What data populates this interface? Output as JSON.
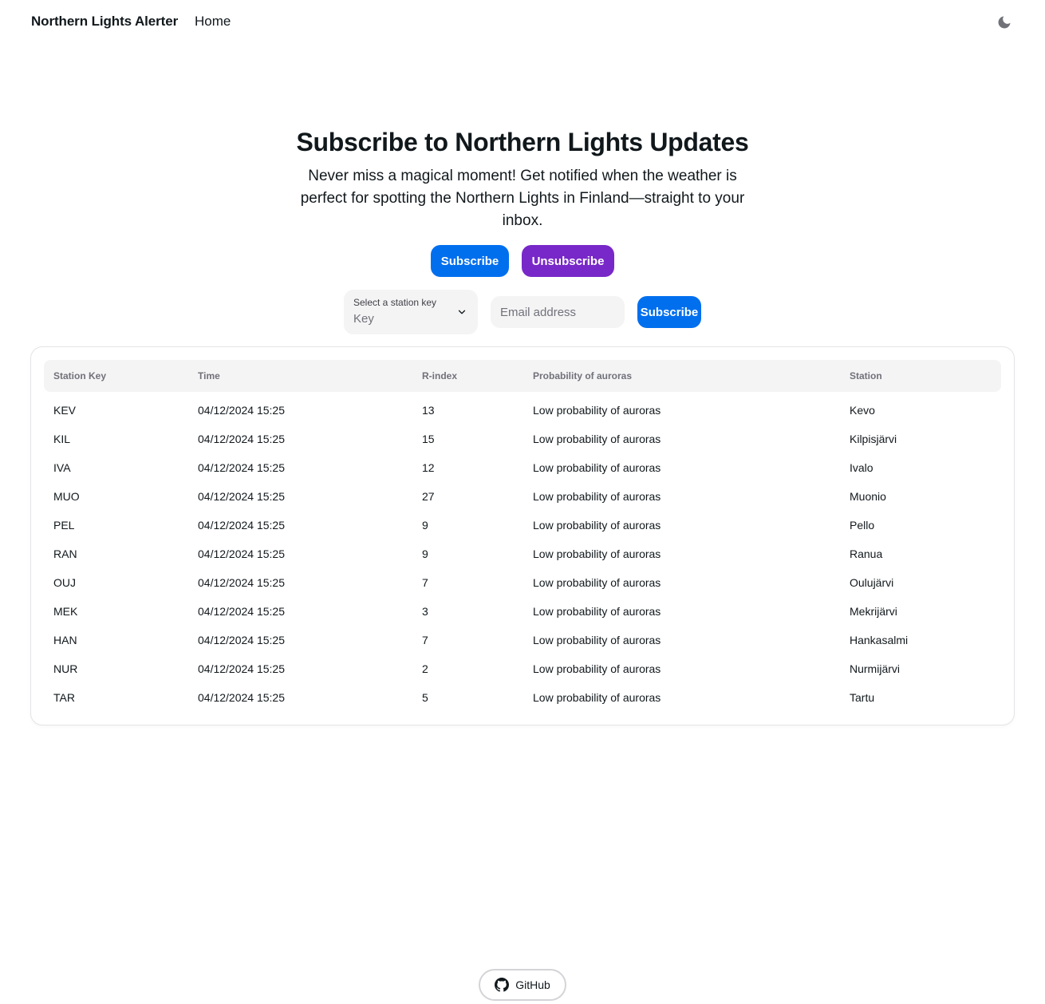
{
  "nav": {
    "brand": "Northern Lights Alerter",
    "home": "Home",
    "theme_icon": "moon-icon"
  },
  "hero": {
    "title": "Subscribe to Northern Lights Updates",
    "description": "Never miss a magical moment! Get notified when the weather is perfect for spotting the Northern Lights in Finland—straight to your inbox."
  },
  "actions": {
    "subscribe": "Subscribe",
    "unsubscribe": "Unsubscribe"
  },
  "form": {
    "select_label": "Select a station key",
    "select_value": "Key",
    "email_placeholder": "Email address",
    "submit": "Subscribe"
  },
  "table": {
    "headers": [
      "Station Key",
      "Time",
      "R-index",
      "Probability of auroras",
      "Station"
    ],
    "rows": [
      [
        "KEV",
        "04/12/2024 15:25",
        "13",
        "Low probability of auroras",
        "Kevo"
      ],
      [
        "KIL",
        "04/12/2024 15:25",
        "15",
        "Low probability of auroras",
        "Kilpisjärvi"
      ],
      [
        "IVA",
        "04/12/2024 15:25",
        "12",
        "Low probability of auroras",
        "Ivalo"
      ],
      [
        "MUO",
        "04/12/2024 15:25",
        "27",
        "Low probability of auroras",
        "Muonio"
      ],
      [
        "PEL",
        "04/12/2024 15:25",
        "9",
        "Low probability of auroras",
        "Pello"
      ],
      [
        "RAN",
        "04/12/2024 15:25",
        "9",
        "Low probability of auroras",
        "Ranua"
      ],
      [
        "OUJ",
        "04/12/2024 15:25",
        "7",
        "Low probability of auroras",
        "Oulujärvi"
      ],
      [
        "MEK",
        "04/12/2024 15:25",
        "3",
        "Low probability of auroras",
        "Mekrijärvi"
      ],
      [
        "HAN",
        "04/12/2024 15:25",
        "7",
        "Low probability of auroras",
        "Hankasalmi"
      ],
      [
        "NUR",
        "04/12/2024 15:25",
        "2",
        "Low probability of auroras",
        "Nurmijärvi"
      ],
      [
        "TAR",
        "04/12/2024 15:25",
        "5",
        "Low probability of auroras",
        "Tartu"
      ]
    ]
  },
  "footer": {
    "github": "GitHub",
    "github_icon": "github-icon"
  },
  "colors": {
    "primary": "#006fee",
    "secondary": "#7828c8",
    "input_bg": "#f4f4f5"
  }
}
